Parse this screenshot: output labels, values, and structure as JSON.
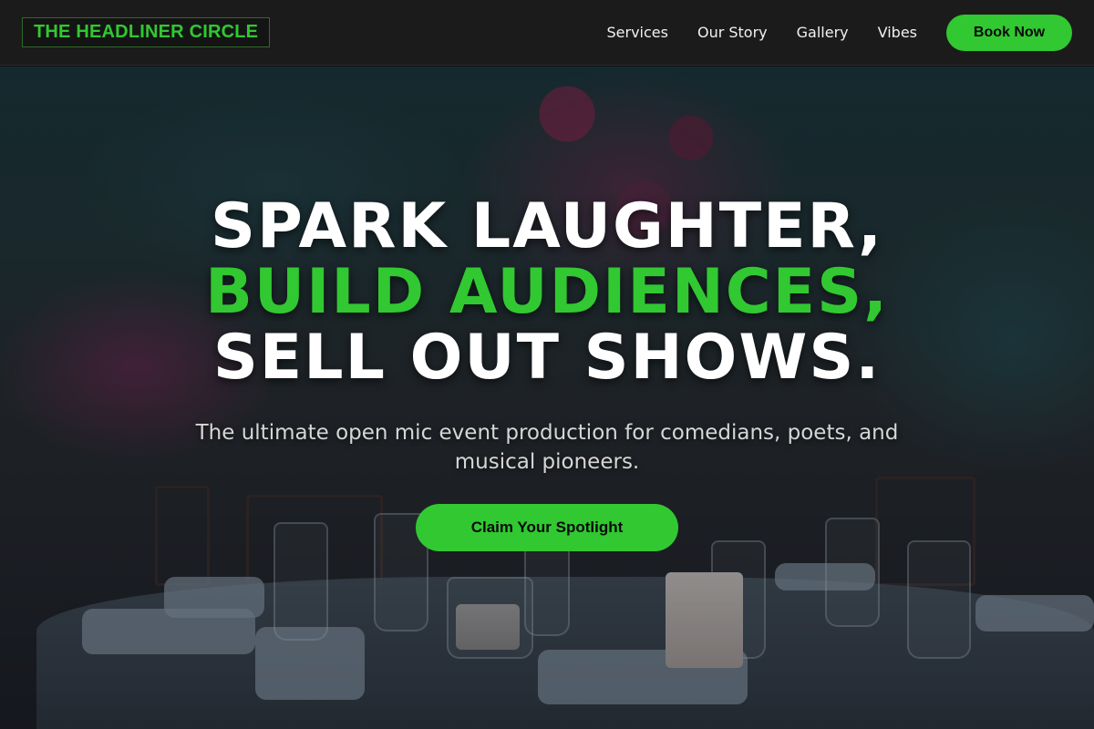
{
  "nav": {
    "logo": "THE HEADLINER CIRCLE",
    "links": [
      "Services",
      "Our Story",
      "Gallery",
      "Vibes"
    ],
    "cta_label": "Book Now"
  },
  "hero": {
    "headline_line1": "SPARK LAUGHTER,",
    "headline_line2": "BUILD AUDIENCES,",
    "headline_line3": "SELL OUT SHOWS.",
    "subtitle": "The ultimate open mic event production for comedians, poets, and musical pioneers.",
    "cta_label": "Claim Your Spotlight",
    "background_image": "dinner-table-event-photo"
  },
  "colors": {
    "accent": "#31c832",
    "nav_background": "#1b1b1b",
    "text_primary": "#ffffff",
    "text_muted": "#d6d6d6"
  }
}
